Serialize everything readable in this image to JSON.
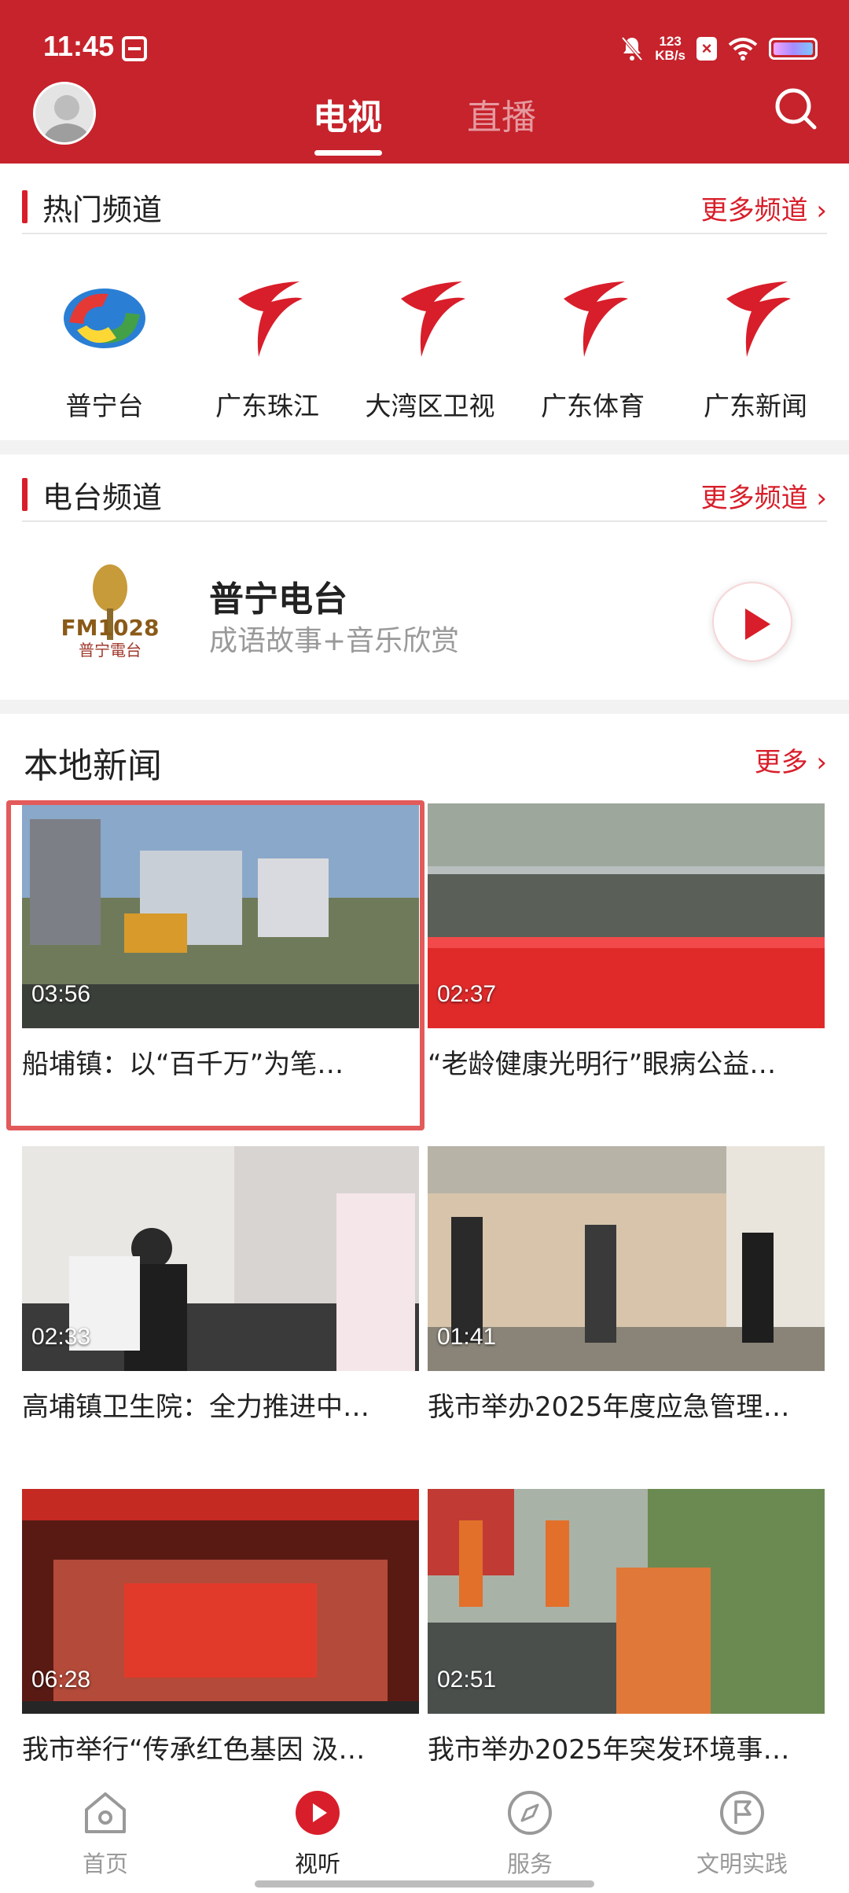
{
  "status_bar": {
    "time": "11:45",
    "speed_value": "123",
    "speed_unit": "KB/s"
  },
  "header": {
    "tabs": [
      {
        "label": "电视",
        "active": true
      },
      {
        "label": "直播",
        "active": false
      }
    ]
  },
  "hot_channels": {
    "title": "热门频道",
    "more": "更多频道 ›",
    "items": [
      {
        "name": "普宁台",
        "icon": "puning-tv-logo"
      },
      {
        "name": "广东珠江",
        "icon": "guangdong-tv-logo"
      },
      {
        "name": "大湾区卫视",
        "icon": "guangdong-tv-logo"
      },
      {
        "name": "广东体育",
        "icon": "guangdong-tv-logo"
      },
      {
        "name": "广东新闻",
        "icon": "guangdong-tv-logo"
      }
    ]
  },
  "radio_channels": {
    "title": "电台频道",
    "more": "更多频道 ›",
    "station": {
      "name": "普宁电台",
      "desc": "成语故事+音乐欣赏",
      "logo_text": "FM1028",
      "logo_sub": "普宁電台"
    }
  },
  "local_news": {
    "title": "本地新闻",
    "more": "更多 ›",
    "items": [
      {
        "duration": "03:56",
        "title": "船埔镇：以“百千万”为笔…"
      },
      {
        "duration": "02:37",
        "title": "“老龄健康光明行”眼病公益…"
      },
      {
        "duration": "02:33",
        "title": "高埔镇卫生院：全力推进中…"
      },
      {
        "duration": "01:41",
        "title": "我市举办2025年度应急管理…"
      },
      {
        "duration": "06:28",
        "title": "我市举行“传承红色基因 汲…"
      },
      {
        "duration": "02:51",
        "title": "我市举办2025年突发环境事…"
      }
    ]
  },
  "bottom_nav": [
    {
      "label": "首页",
      "icon": "home-icon",
      "active": false
    },
    {
      "label": "视听",
      "icon": "play-circle-icon",
      "active": true
    },
    {
      "label": "服务",
      "icon": "compass-icon",
      "active": false
    },
    {
      "label": "文明实践",
      "icon": "flag-circle-icon",
      "active": false
    }
  ],
  "colors": {
    "brand": "#c6232c",
    "accent": "#d81e2a"
  }
}
